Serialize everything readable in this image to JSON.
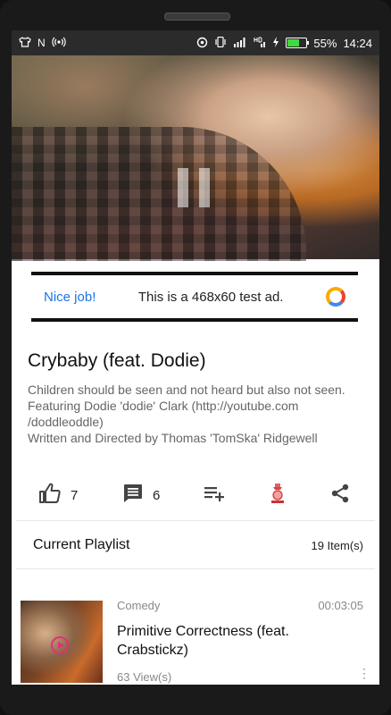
{
  "status_bar": {
    "battery_percent": "55%",
    "time": "14:24",
    "carrier_letter": "N",
    "battery_level": 0.55
  },
  "ad": {
    "left_text": "Nice job!",
    "main_text": "This is a 468x60 test ad."
  },
  "video": {
    "title": "Crybaby (feat. Dodie)",
    "description_lines": [
      "Children should be seen and not heard but also not seen.",
      "Featuring Dodie 'dodie' Clark (http://youtube.com /doddleoddle)",
      "Written and Directed by Thomas 'TomSka' Ridgewell"
    ],
    "likes": "7",
    "comments": "6"
  },
  "playlist": {
    "title": "Current Playlist",
    "count": "19 Item(s)",
    "items": [
      {
        "category": "Comedy",
        "duration": "00:03:05",
        "title": "Primitive Correctness (feat. Crabstickz)",
        "views": "63 View(s)"
      }
    ]
  },
  "colors": {
    "accent_blue": "#1a73e8",
    "status_bar_bg": "#2b2b2b",
    "icon_grey": "#444444",
    "secondary_text": "#666666"
  }
}
